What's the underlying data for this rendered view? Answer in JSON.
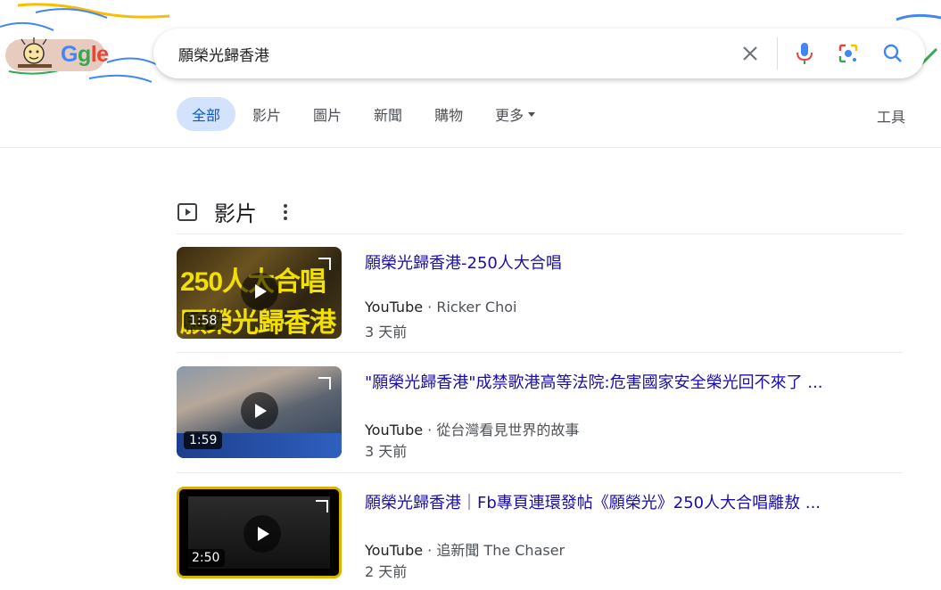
{
  "search": {
    "query": "願榮光歸香港"
  },
  "logo": {
    "text_g": "G",
    "text_rest": "gle"
  },
  "tabs": [
    {
      "label": "全部",
      "active": true
    },
    {
      "label": "影片",
      "active": false
    },
    {
      "label": "圖片",
      "active": false
    },
    {
      "label": "新聞",
      "active": false
    },
    {
      "label": "購物",
      "active": false
    },
    {
      "label": "更多",
      "active": false
    }
  ],
  "tools_label": "工具",
  "section": {
    "title": "影片"
  },
  "videos": [
    {
      "title": "願榮光歸香港-250人大合唱",
      "source": "YouTube",
      "channel": "Ricker Choi",
      "date": "3 天前",
      "duration": "1:58",
      "thumb_caption_top": "250人大合唱",
      "thumb_caption_bottom": "願榮光歸香港"
    },
    {
      "title": "\"願榮光歸香港\"成禁歌港高等法院:危害國家安全榮光回不來了 ...",
      "source": "YouTube",
      "channel": "從台灣看見世界的故事",
      "date": "3 天前",
      "duration": "1:59"
    },
    {
      "title": "願榮光歸香港｜Fb專頁連環發帖《願榮光》250人大合唱離敖 ...",
      "source": "YouTube",
      "channel": "追新聞 The Chaser",
      "date": "2 天前",
      "duration": "2:50"
    }
  ],
  "colors": {
    "link": "#1a0dab",
    "active_tab_bg": "#d3e3fd",
    "active_tab_text": "#0b57d0",
    "google_blue": "#4285f4",
    "google_red": "#ea4335",
    "google_yellow": "#fbbc04",
    "google_green": "#34a853"
  },
  "icons": [
    "clear-icon",
    "mic-icon",
    "lens-icon",
    "search-icon",
    "video-section-icon",
    "more-vert-icon",
    "play-icon",
    "expand-icon"
  ]
}
